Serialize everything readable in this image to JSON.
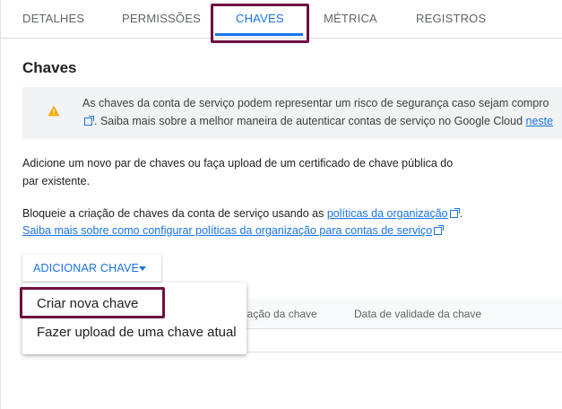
{
  "tabs": [
    {
      "label": "DETALHES"
    },
    {
      "label": "PERMISSÕES"
    },
    {
      "label": "CHAVES",
      "active": true
    },
    {
      "label": "MÉTRICA"
    },
    {
      "label": "REGISTROS"
    }
  ],
  "page_title": "Chaves",
  "banner": {
    "icon": "warning-icon",
    "line1": "As chaves da conta de serviço podem representar um risco de segurança caso sejam compro",
    "line2_text": ". Saiba mais sobre a melhor maneira de autenticar contas de serviço no Google Cloud ",
    "line2_link": "neste"
  },
  "description": {
    "line1": "Adicione um novo par de chaves ou faça upload de um certificado de chave pública do",
    "line2": "par existente."
  },
  "policy": {
    "prefix": "Bloqueie a criação de chaves da conta de serviço usando as ",
    "link1": "políticas da organização",
    "suffix": ".",
    "link2": "Saiba mais sobre como configurar políticas da organização para contas de serviço"
  },
  "add_key_button": {
    "label": "ADICIONAR CHAVE"
  },
  "table": {
    "columns": [
      "criação da chave",
      "Data de validade da chave"
    ]
  },
  "dropdown_menu": {
    "items": [
      "Criar nova chave",
      "Fazer upload de uma chave atual"
    ]
  },
  "colors": {
    "accent": "#1a73e8",
    "highlight": "#6d1041",
    "warning": "#f9ab00"
  }
}
